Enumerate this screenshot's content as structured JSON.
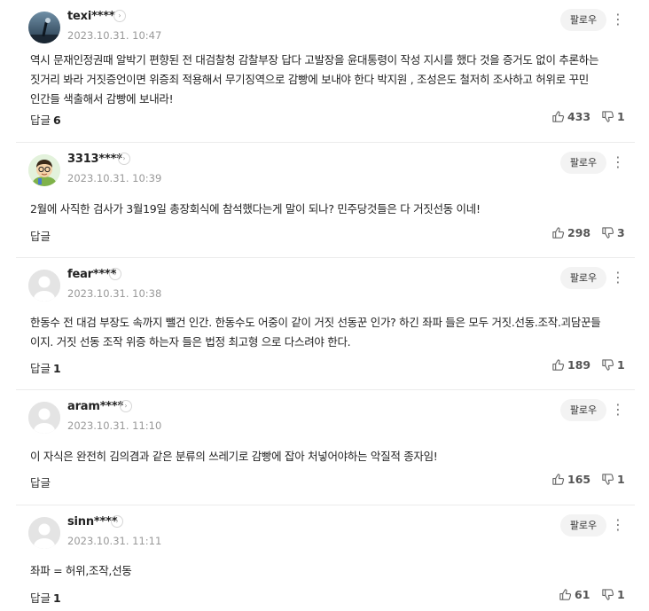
{
  "follow_label": "팔로우",
  "reply_label": "답글",
  "comments": [
    {
      "nickname": "texi****",
      "date": "2023.10.31. 10:47",
      "body": "역시 문재인정권때 알박기 편향된 전 대검찰청 감찰부장 답다 고발장을 윤대통령이 작성 지시를 했다 것을 증거도 없이 추론하는 짓거리 봐라 거짓증언이면 위증죄 적용해서 무기징역으로 감빵에 보내야 한다 박지원 , 조성은도 철저히 조사하고 허위로 꾸민 인간들 색출해서 감빵에 보내라!",
      "reply_count": "6",
      "likes": "433",
      "dislikes": "1",
      "avatar": "photo"
    },
    {
      "nickname": "3313****",
      "date": "2023.10.31. 10:39",
      "body": "2월에 사직한 검사가 3월19일 총장회식에 참석했다는게 말이 되나? 민주당것들은 다 거짓선동 이네!",
      "reply_count": "",
      "likes": "298",
      "dislikes": "3",
      "avatar": "cartoon"
    },
    {
      "nickname": "fear****",
      "date": "2023.10.31. 10:38",
      "body": "한동수 전 대검 부장도 속까지 뺄건 인간. 한동수도 어중이 같이 거짓 선동꾼 인가? 하긴 좌파 들은 모두 거짓.선동.조작.괴담꾼들 이지. 거짓 선동 조작 위증 하는자 들은 법정 최고형 으로 다스려야 한다.",
      "reply_count": "1",
      "likes": "189",
      "dislikes": "1",
      "avatar": "default"
    },
    {
      "nickname": "aram****",
      "date": "2023.10.31. 11:10",
      "body": "이 자식은 완전히 김의겸과 같은 분류의 쓰레기로 감빵에 잡아 처넣어야하는 악질적 종자임!",
      "reply_count": "",
      "likes": "165",
      "dislikes": "1",
      "avatar": "default"
    },
    {
      "nickname": "sinn****",
      "date": "2023.10.31. 11:11",
      "body": "좌파 = 허위,조작,선동",
      "reply_count": "1",
      "likes": "61",
      "dislikes": "1",
      "avatar": "default"
    }
  ]
}
